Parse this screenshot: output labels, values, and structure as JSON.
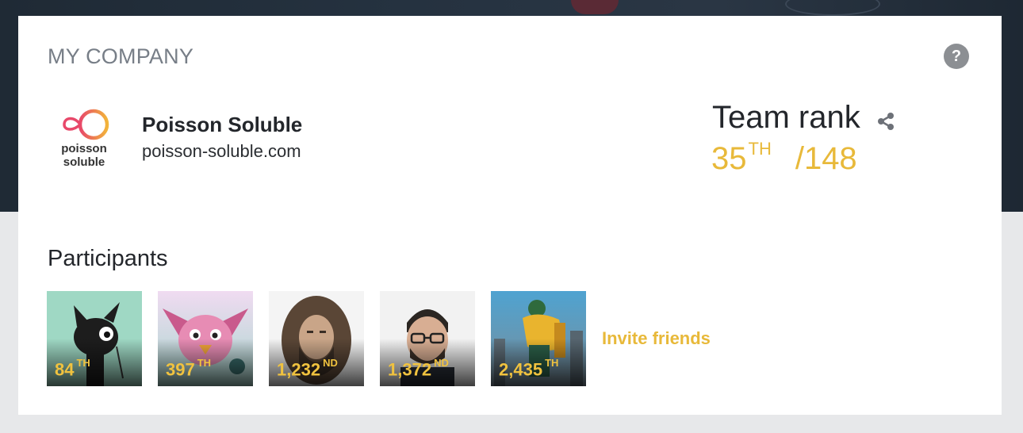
{
  "section_title": "MY COMPANY",
  "help_icon": "question-mark-icon",
  "company": {
    "logo_text_line1": "poisson",
    "logo_text_line2": "soluble",
    "name": "Poisson Soluble",
    "url": "poisson-soluble.com"
  },
  "team_rank": {
    "label": "Team rank",
    "share_icon": "share-icon",
    "rank": "35",
    "suffix": "TH",
    "total": "/148"
  },
  "participants": {
    "title": "Participants",
    "items": [
      {
        "rank": "84",
        "suffix": "TH",
        "avatar": "black-cat-avatar"
      },
      {
        "rank": "397",
        "suffix": "TH",
        "avatar": "pink-bird-avatar"
      },
      {
        "rank": "1,232",
        "suffix": "ND",
        "avatar": "long-haired-man-photo"
      },
      {
        "rank": "1,372",
        "suffix": "ND",
        "avatar": "man-with-glasses-photo"
      },
      {
        "rank": "2,435",
        "suffix": "TH",
        "avatar": "anime-hero-avatar"
      }
    ],
    "invite_label": "Invite friends"
  },
  "colors": {
    "accent": "#e8b93a",
    "title_gray": "#777e87",
    "text_dark": "#23262b"
  }
}
